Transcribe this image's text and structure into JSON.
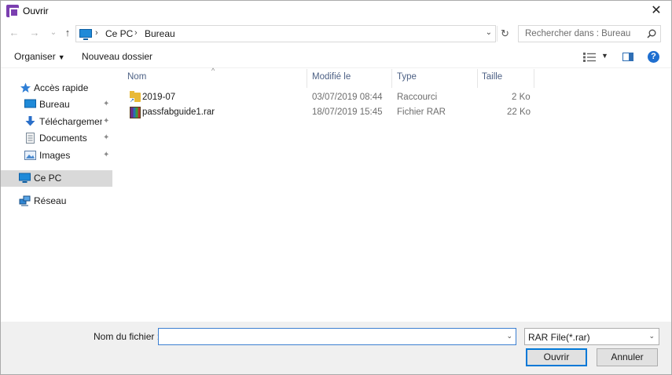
{
  "window": {
    "title": "Ouvrir",
    "close_glyph": "✕"
  },
  "nav": {
    "back_glyph": "←",
    "forward_glyph": "→",
    "recent_glyph": "⌄",
    "up_glyph": "↑",
    "breadcrumb": [
      "Ce PC",
      "Bureau"
    ],
    "sep_glyph": "›",
    "refresh_glyph": "↻",
    "search_placeholder": "Rechercher dans : Bureau"
  },
  "toolbar": {
    "organize_label": "Organiser",
    "new_folder_label": "Nouveau dossier",
    "help_label": "?"
  },
  "sidebar": {
    "items": [
      {
        "label": "Accès rapide",
        "icon": "star-icon"
      },
      {
        "label": "Bureau",
        "icon": "desktop-icon",
        "pinned": true
      },
      {
        "label": "Téléchargements",
        "icon": "downloads-icon",
        "pinned": true
      },
      {
        "label": "Documents",
        "icon": "documents-icon",
        "pinned": true
      },
      {
        "label": "Images",
        "icon": "images-icon",
        "pinned": true
      },
      {
        "label": "Ce PC",
        "icon": "pc-icon",
        "selected": true
      },
      {
        "label": "Réseau",
        "icon": "network-icon"
      }
    ],
    "pin_glyph": "📌"
  },
  "filelist": {
    "columns": [
      "Nom",
      "Modifié le",
      "Type",
      "Taille"
    ],
    "sort_glyph": "^",
    "rows": [
      {
        "name": "2019-07",
        "modified": "03/07/2019 08:44",
        "type": "Raccourci",
        "size": "2 Ko",
        "icon": "folder-shortcut-icon"
      },
      {
        "name": "passfabguide1.rar",
        "modified": "18/07/2019 15:45",
        "type": "Fichier RAR",
        "size": "22 Ko",
        "icon": "rar-archive-icon"
      }
    ]
  },
  "bottom": {
    "filename_label": "Nom du fichier :",
    "filename_value": "",
    "filetype_value": "RAR File(*.rar)",
    "open_label": "Ouvrir",
    "cancel_label": "Annuler",
    "drop_glyph": "⌄"
  },
  "colors": {
    "accent": "#0078d7",
    "selected_bg": "#d9d9d9",
    "column_header": "#4d6185"
  }
}
